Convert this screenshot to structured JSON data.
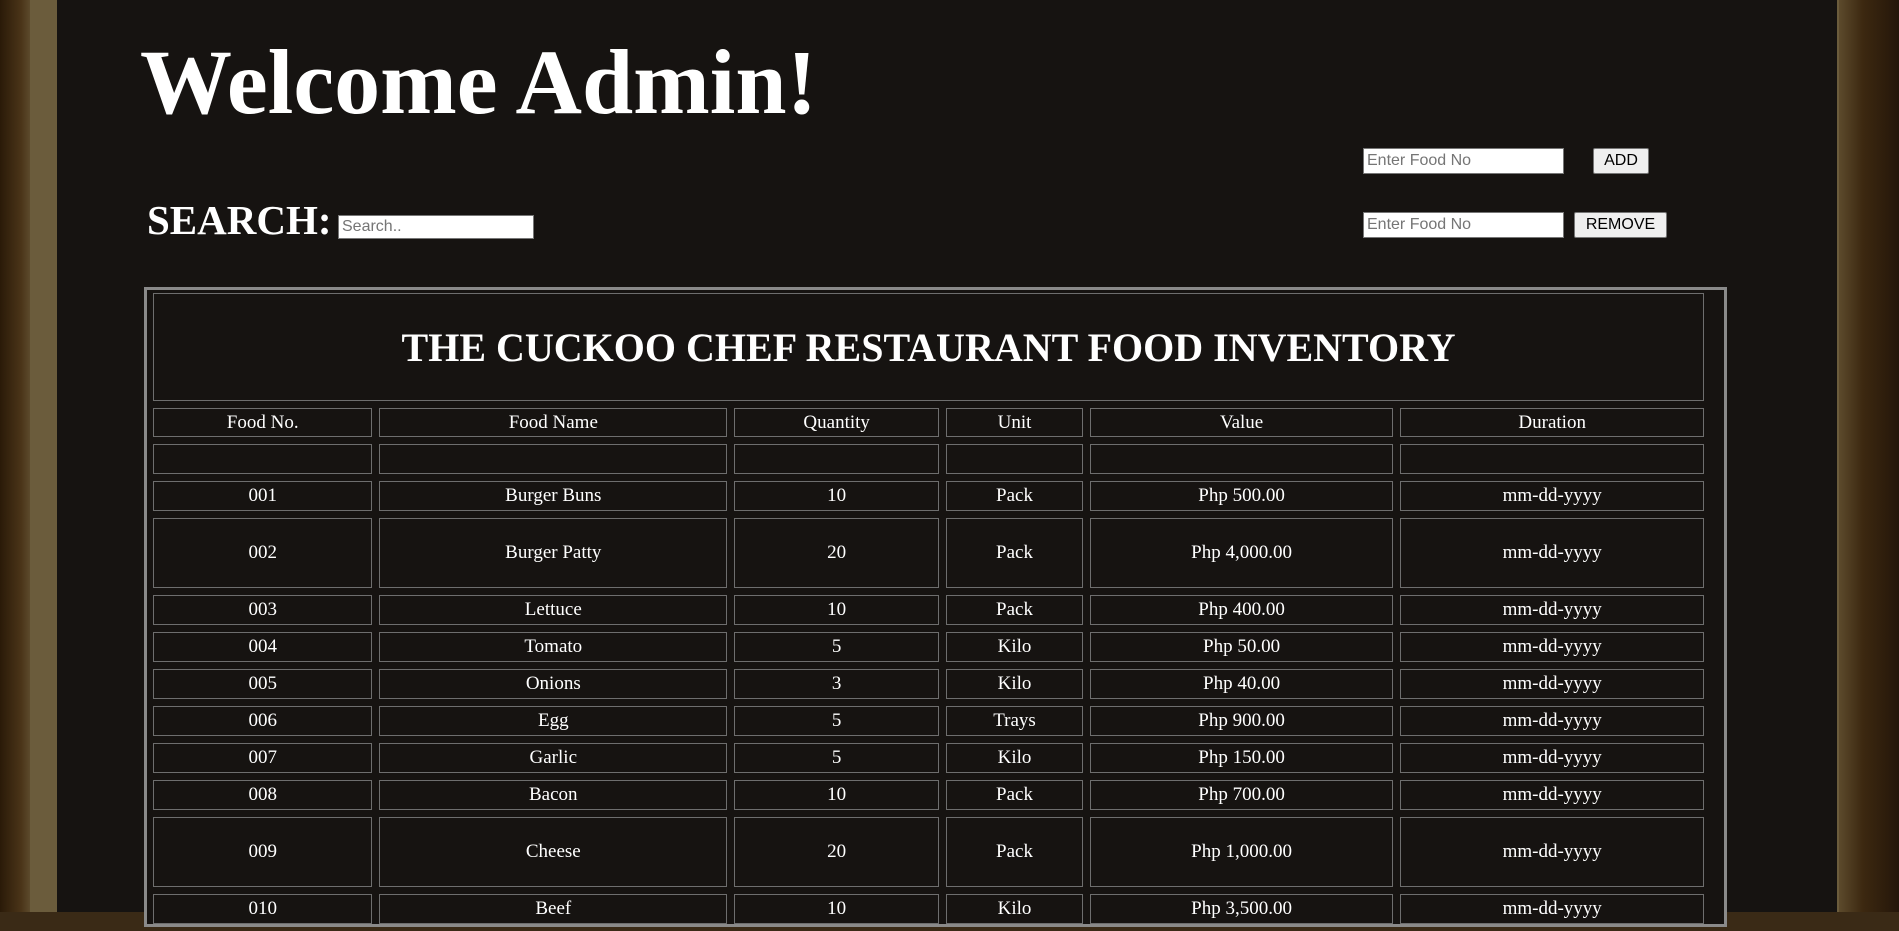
{
  "header": {
    "welcome_text": "Welcome Admin!"
  },
  "search": {
    "label": "SEARCH:",
    "placeholder": "Search.."
  },
  "actions": {
    "add_input_placeholder": "Enter Food No",
    "add_button_label": "ADD",
    "remove_input_placeholder": "Enter Food No",
    "remove_button_label": "REMOVE"
  },
  "table": {
    "title": "THE CUCKOO CHEF RESTAURANT FOOD INVENTORY",
    "columns": [
      "Food No.",
      "Food Name",
      "Quantity",
      "Unit",
      "Value",
      "Duration"
    ],
    "rows": [
      [
        "001",
        "Burger Buns",
        "10",
        "Pack",
        "Php 500.00",
        "mm-dd-yyyy"
      ],
      [
        "002",
        "Burger Patty",
        "20",
        "Pack",
        "Php 4,000.00",
        "mm-dd-yyyy"
      ],
      [
        "003",
        "Lettuce",
        "10",
        "Pack",
        "Php 400.00",
        "mm-dd-yyyy"
      ],
      [
        "004",
        "Tomato",
        "5",
        "Kilo",
        "Php 50.00",
        "mm-dd-yyyy"
      ],
      [
        "005",
        "Onions",
        "3",
        "Kilo",
        "Php 40.00",
        "mm-dd-yyyy"
      ],
      [
        "006",
        "Egg",
        "5",
        "Trays",
        "Php 900.00",
        "mm-dd-yyyy"
      ],
      [
        "007",
        "Garlic",
        "5",
        "Kilo",
        "Php 150.00",
        "mm-dd-yyyy"
      ],
      [
        "008",
        "Bacon",
        "10",
        "Pack",
        "Php 700.00",
        "mm-dd-yyyy"
      ],
      [
        "009",
        "Cheese",
        "20",
        "Pack",
        "Php 1,000.00",
        "mm-dd-yyyy"
      ],
      [
        "010",
        "Beef",
        "10",
        "Kilo",
        "Php 3,500.00",
        "mm-dd-yyyy"
      ]
    ]
  },
  "colors": {
    "panel_background": "#161311",
    "frame": "#6b5c3c",
    "text": "#ffffff"
  }
}
